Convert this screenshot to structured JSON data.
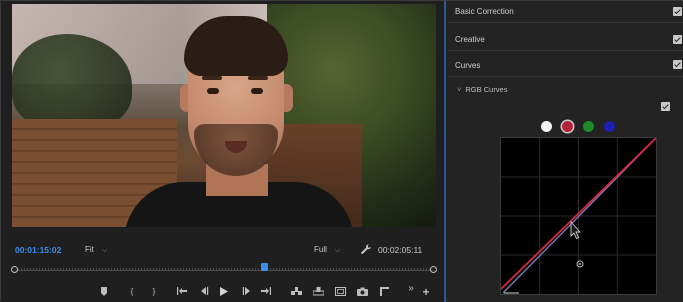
{
  "monitor": {
    "timecode_current": "00:01:15:02",
    "zoom": "Fit",
    "resolution": "Full",
    "timecode_total": "00:02:05:11",
    "playhead_fraction": 0.6
  },
  "transport": {
    "buttons": [
      {
        "name": "add-marker-icon"
      },
      {
        "name": "mark-in-icon",
        "label": "{"
      },
      {
        "name": "mark-out-icon",
        "label": "}"
      },
      {
        "name": "go-to-in-icon"
      },
      {
        "name": "step-back-icon"
      },
      {
        "name": "play-icon"
      },
      {
        "name": "step-forward-icon"
      },
      {
        "name": "go-to-out-icon"
      },
      {
        "name": "insert-icon"
      },
      {
        "name": "overwrite-icon"
      },
      {
        "name": "safe-margins-icon"
      },
      {
        "name": "export-frame-icon"
      },
      {
        "name": "compare-view-icon"
      },
      {
        "name": "more-icon",
        "label": "»"
      },
      {
        "name": "add-button-icon",
        "label": "+"
      }
    ]
  },
  "lumetri": {
    "sections": [
      {
        "label": "Basic Correction",
        "checked": true
      },
      {
        "label": "Creative",
        "checked": true
      },
      {
        "label": "Curves",
        "checked": true
      }
    ],
    "rgb_curves_label": "RGB Curves",
    "rgb_curves_checked": true,
    "channels": [
      {
        "name": "white",
        "color": "#f2f2f2"
      },
      {
        "name": "red",
        "color": "#b3223a",
        "selected": true
      },
      {
        "name": "green",
        "color": "#1f8a2a"
      },
      {
        "name": "blue",
        "color": "#1d1fb0"
      }
    ],
    "curve_colors": {
      "red": "#d8283f",
      "luma": "#7c7bb8"
    }
  }
}
